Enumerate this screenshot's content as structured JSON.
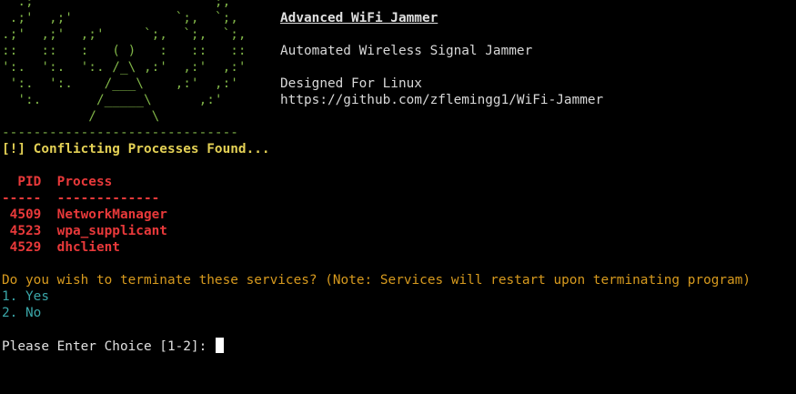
{
  "banner": {
    "art_lines": [
      "  .;'                     `;,",
      " .;'  ,;'             `;,  `;,",
      ".;'  ,;'  ,;'     `;,  `;,  `;,",
      "::   ::   :   ( )   :   ::   ::",
      "':.  ':.  ':. /_\\ ,:'  ,:'  ,:'",
      " ':.  ':.    /___\\    ,:'  ,:'",
      "  ':.       /_____\\      ,:'",
      "           /       \\"
    ],
    "title": "Advanced WiFi Jammer",
    "subtitle": "Automated Wireless Signal Jammer",
    "platform": "Designed For Linux",
    "url": "https://github.com/zflemingg1/WiFi-Jammer",
    "divider": "------------------------------"
  },
  "warning": "[!] Conflicting Processes Found...",
  "process_table": {
    "headers": {
      "pid": "PID",
      "process": "Process"
    },
    "separators": {
      "pid": "-----",
      "process": "-------------"
    },
    "rows": [
      {
        "pid": "4509",
        "process": "NetworkManager"
      },
      {
        "pid": "4523",
        "process": "wpa_supplicant"
      },
      {
        "pid": "4529",
        "process": "dhclient"
      }
    ]
  },
  "prompt": {
    "question": "Do you wish to terminate these services? (Note: Services will restart upon terminating program)",
    "options": [
      "1. Yes",
      "2. No"
    ],
    "input_label": "Please Enter Choice [1-2]: ",
    "input_value": ""
  },
  "colors": {
    "background": "#000000",
    "art": "#7fb347",
    "warning": "#e3d055",
    "table": "#e8393a",
    "question": "#d79a1e",
    "options": "#3aa6a8",
    "text": "#d8d8d8"
  }
}
